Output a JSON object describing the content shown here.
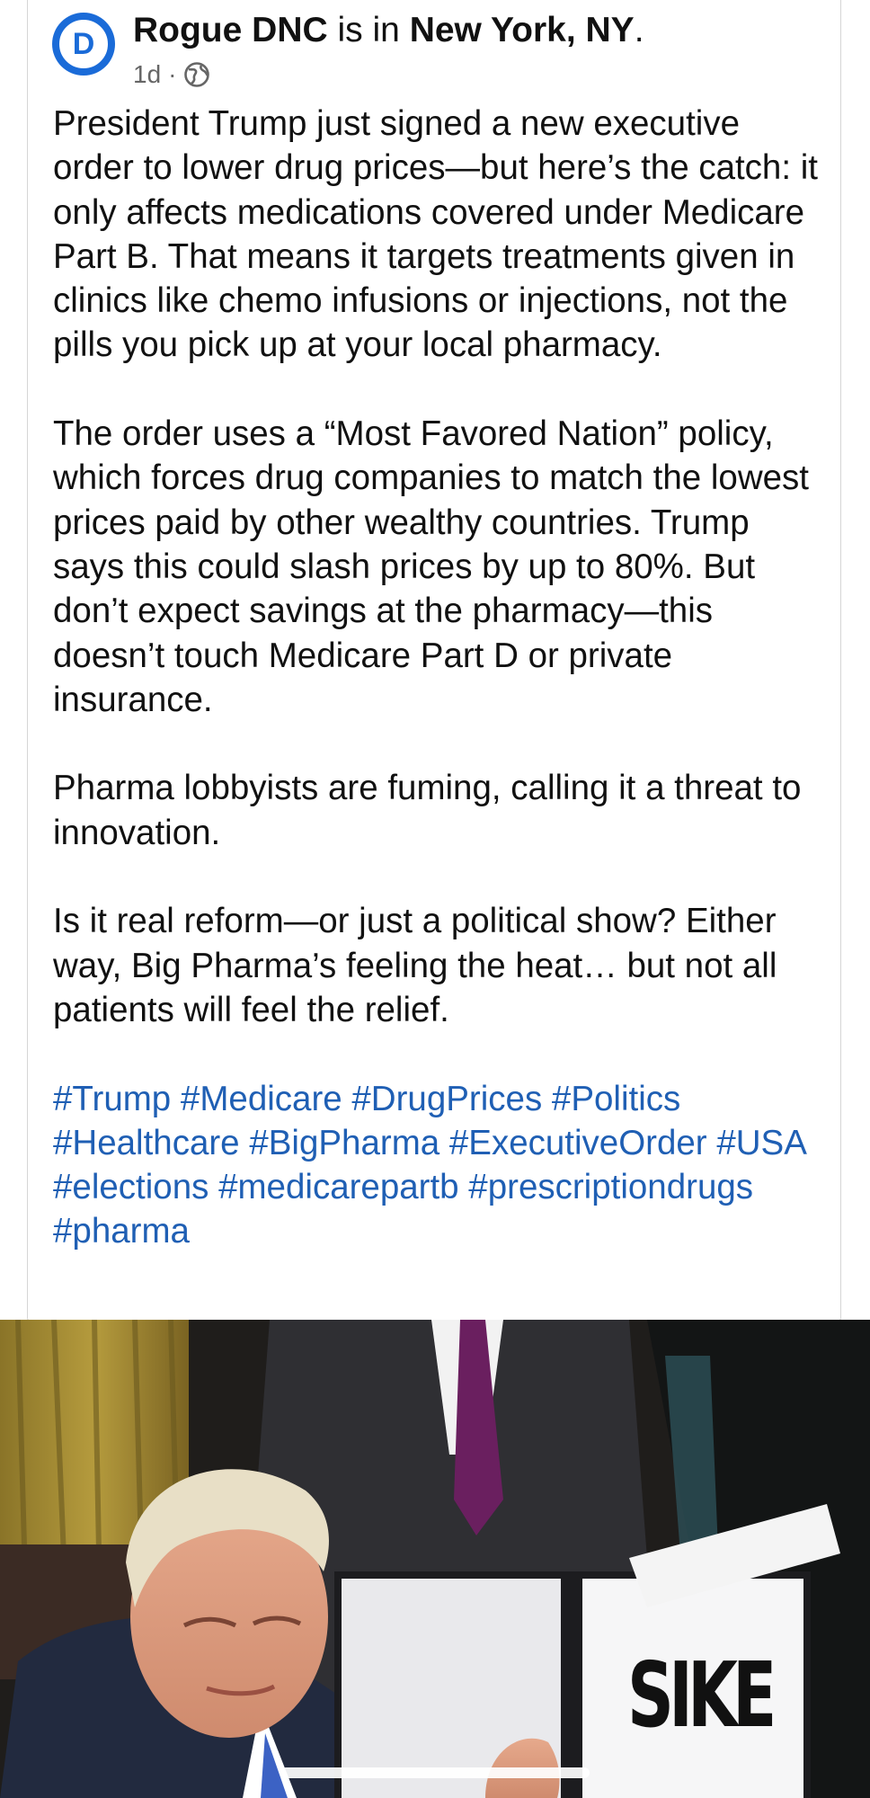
{
  "post": {
    "author": "Rogue DNC",
    "location_prefix": "is in",
    "location": "New York, NY",
    "location_suffix": ".",
    "time": "1d",
    "separator": "·",
    "avatar_letter": "D",
    "paragraphs": [
      "President Trump just signed a new executive order to lower drug prices—but here’s the catch: it only affects medications covered under Medicare Part B. That means it targets treatments given in clinics like chemo infusions or injections, not the pills you pick up at your local pharmacy.",
      "The order uses a “Most Favored Nation” policy, which forces drug companies to match the lowest prices paid by other wealthy countries. Trump says this could slash prices by up to 80%. But don’t expect savings at the pharmacy—this doesn’t touch Medicare Part D or private insurance.",
      "Pharma lobbyists are fuming, calling it a threat to innovation.",
      "Is it real reform—or just a political show? Either way, Big Pharma’s feeling the heat… but not all patients will feel the relief."
    ],
    "hashtags": [
      "#Trump",
      "#Medicare",
      "#DrugPrices",
      "#Politics",
      "#Healthcare",
      "#BigPharma",
      "#ExecutiveOrder",
      "#USA",
      "#elections",
      "#medicarepartb",
      "#prescriptiondrugs",
      "#pharma"
    ]
  },
  "image": {
    "overlay_text": "SIKE"
  },
  "icons": {
    "privacy": "globe-icon",
    "avatar": "democratic-d-logo"
  },
  "colors": {
    "hashtag": "#1f5fb4",
    "avatar_blue": "#1a6bd8",
    "meta_gray": "#666666"
  }
}
